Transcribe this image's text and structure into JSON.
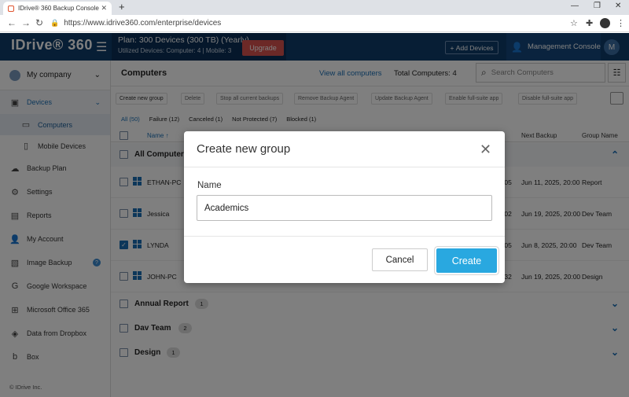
{
  "browser": {
    "tab_title": "IDrive® 360 Backup Console for",
    "url": "https://www.idrive360.com/enterprise/devices"
  },
  "app": {
    "logo": "IDrive® 360",
    "plan": "Plan: 300 Devices (300 TB) (Yearly)",
    "usage": "Utilized Devices: Computer: 4 |   Mobile: 3",
    "upgrade": "Upgrade",
    "add_devices": "Add Devices",
    "management_console": "Management Console",
    "user_initial": "M"
  },
  "sidebar": {
    "company": "My company",
    "items": [
      {
        "label": "Devices"
      },
      {
        "label": "Computers"
      },
      {
        "label": "Mobile Devices"
      },
      {
        "label": "Backup Plan"
      },
      {
        "label": "Settings"
      },
      {
        "label": "Reports"
      },
      {
        "label": "My Account"
      },
      {
        "label": "Image Backup"
      },
      {
        "label": "Google Workspace"
      },
      {
        "label": "Microsoft Office 365"
      },
      {
        "label": "Data from Dropbox"
      },
      {
        "label": "Box"
      }
    ],
    "copyright": "© IDrive Inc."
  },
  "main": {
    "title": "Computers",
    "view_all": "View all computers",
    "total": "Total Computers: 4",
    "search_placeholder": "Search Computers",
    "toolbar": [
      "Create new group",
      "Delete",
      "Stop all current backups",
      "Remove Backup Agent",
      "Update Backup Agent",
      "Enable full-suite app",
      "Disable full-suite app"
    ],
    "filters": [
      "All (50)",
      "Failure (12)",
      "Canceled (1)",
      "Not Protected (7)",
      "Blocked (1)"
    ],
    "columns": {
      "name": "Name",
      "next_backup": "Next Backup",
      "group": "Group Name"
    },
    "all_computers": "All Computers",
    "rows": [
      {
        "name": "ETHAN-PC",
        "time": ":05",
        "next": "Jun 11, 2025, 20:00",
        "group": "Report"
      },
      {
        "name": "Jessica",
        "time": ":02",
        "next": "Jun 19, 2025, 20:00",
        "group": "Dev Team"
      },
      {
        "name": "LYNDA",
        "time": ":05",
        "next": "Jun 8, 2025, 20:00",
        "group": "Dev Team"
      },
      {
        "name": "JOHN-PC",
        "time": ":32",
        "next": "Jun 19, 2025, 20:00",
        "group": "Design"
      }
    ],
    "groups": [
      {
        "name": "Annual Report",
        "count": "1"
      },
      {
        "name": "Dav Team",
        "count": "2"
      },
      {
        "name": "Design",
        "count": "1"
      }
    ]
  },
  "modal": {
    "title": "Create new group",
    "name_label": "Name",
    "name_value": "Academics",
    "cancel": "Cancel",
    "create": "Create"
  }
}
